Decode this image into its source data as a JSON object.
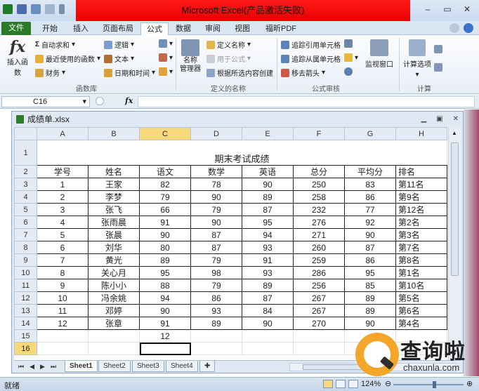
{
  "titlebar": {
    "title": "Microsoft Excel(产品激活失败)"
  },
  "ribbon_tabs": [
    "文件",
    "开始",
    "插入",
    "页面布局",
    "公式",
    "数据",
    "审阅",
    "视图",
    "福昕PDF"
  ],
  "ribbon": {
    "insert_function": "插入函数",
    "autosum": "自动求和",
    "recent": "最近使用的函数",
    "financial": "财务",
    "logical": "逻辑",
    "text": "文本",
    "datetime": "日期和时间",
    "function_library": "函数库",
    "name_manager": "名称\n管理器",
    "define_name": "定义名称",
    "use_in_formula": "用于公式",
    "create_from_selection": "根据所选内容创建",
    "defined_names": "定义的名称",
    "trace_precedents": "追踪引用单元格",
    "trace_dependents": "追踪从属单元格",
    "remove_arrows": "移去箭头",
    "formula_auditing": "公式审核",
    "watch_window": "监视窗口",
    "calc_options": "计算选项",
    "calculation": "计算"
  },
  "formula_bar": {
    "name_box": "C16",
    "fx": "fx",
    "formula": ""
  },
  "workbook": {
    "title": "成绩单.xlsx"
  },
  "sheet": {
    "columns": [
      "A",
      "B",
      "C",
      "D",
      "E",
      "F",
      "G",
      "H"
    ],
    "selected_column": "C",
    "row_numbers": [
      "1",
      "2",
      "3",
      "4",
      "5",
      "6",
      "7",
      "8",
      "9",
      "10",
      "11",
      "12",
      "13",
      "14",
      "15",
      "16"
    ],
    "caption": "期末考试成绩",
    "headers": [
      "学号",
      "姓名",
      "语文",
      "数学",
      "英语",
      "总分",
      "平均分",
      "排名"
    ],
    "rows": [
      [
        "1",
        "王家",
        "82",
        "78",
        "90",
        "250",
        "83",
        "第11名"
      ],
      [
        "2",
        "李梦",
        "79",
        "90",
        "89",
        "258",
        "86",
        "第9名"
      ],
      [
        "3",
        "张飞",
        "66",
        "79",
        "87",
        "232",
        "77",
        "第12名"
      ],
      [
        "4",
        "张雨晨",
        "91",
        "90",
        "95",
        "276",
        "92",
        "第2名"
      ],
      [
        "5",
        "张晨",
        "90",
        "87",
        "94",
        "271",
        "90",
        "第3名"
      ],
      [
        "6",
        "刘华",
        "80",
        "87",
        "93",
        "260",
        "87",
        "第7名"
      ],
      [
        "7",
        "黄光",
        "89",
        "79",
        "91",
        "259",
        "86",
        "第8名"
      ],
      [
        "8",
        "关心月",
        "95",
        "98",
        "93",
        "286",
        "95",
        "第1名"
      ],
      [
        "9",
        "陈小小",
        "88",
        "79",
        "89",
        "256",
        "85",
        "第10名"
      ],
      [
        "10",
        "冯余姚",
        "94",
        "86",
        "87",
        "267",
        "89",
        "第5名"
      ],
      [
        "11",
        "邓婷",
        "90",
        "93",
        "84",
        "267",
        "89",
        "第6名"
      ],
      [
        "12",
        "张章",
        "91",
        "89",
        "90",
        "270",
        "90",
        "第4名"
      ]
    ],
    "row15_c": "12",
    "active_cell": "C16"
  },
  "sheet_tabs": [
    "Sheet1",
    "Sheet2",
    "Sheet3",
    "Sheet4"
  ],
  "status": {
    "ready": "就绪",
    "zoom": "124%"
  },
  "watermark": {
    "brand": "查询啦",
    "domain": "chaxunla.com"
  },
  "colors": {
    "file_tab": "#2a7a28",
    "title_red": "#e60000",
    "selection": "#f8d97a",
    "logo_orange": "#f3a62a"
  }
}
